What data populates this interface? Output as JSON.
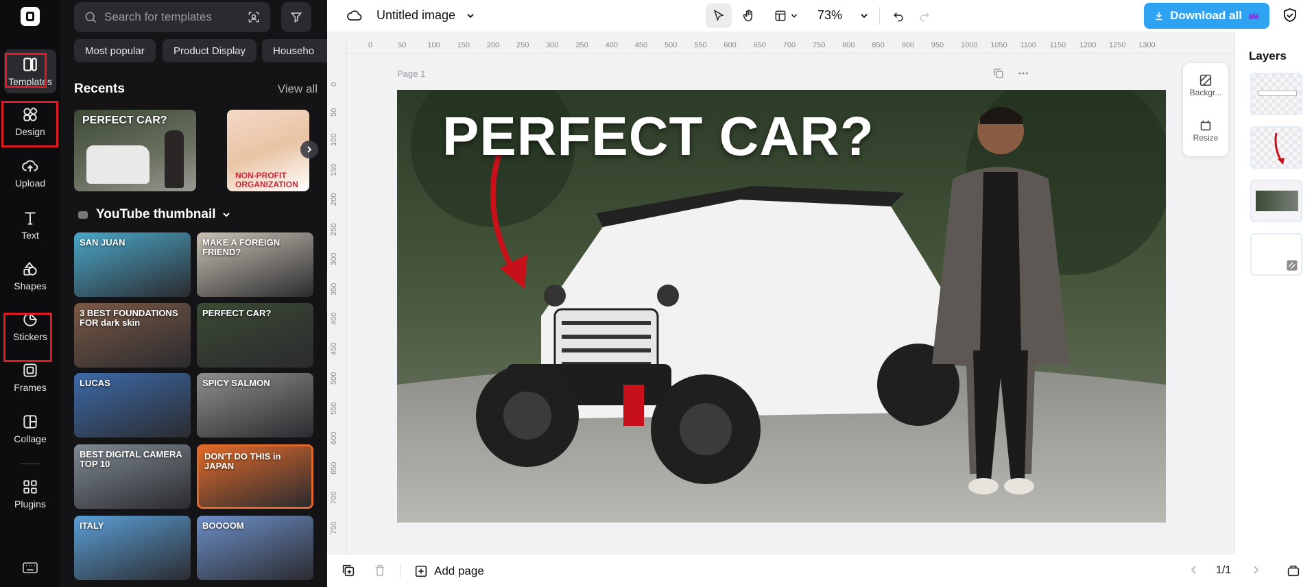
{
  "rail": {
    "items": [
      {
        "label": "Templates",
        "icon": "templates-icon"
      },
      {
        "label": "Design",
        "icon": "design-icon"
      },
      {
        "label": "Upload",
        "icon": "upload-icon"
      },
      {
        "label": "Text",
        "icon": "text-icon"
      },
      {
        "label": "Shapes",
        "icon": "shapes-icon"
      },
      {
        "label": "Stickers",
        "icon": "stickers-icon"
      },
      {
        "label": "Frames",
        "icon": "frames-icon"
      },
      {
        "label": "Collage",
        "icon": "collage-icon"
      },
      {
        "label": "Plugins",
        "icon": "plugins-icon"
      }
    ],
    "active": "Templates"
  },
  "panel": {
    "search_placeholder": "Search for templates",
    "chips": [
      "Most popular",
      "Product Display",
      "Househo"
    ],
    "recents_title": "Recents",
    "view_all": "View all",
    "recents": [
      {
        "text": "PERFECT CAR?"
      },
      {
        "text": "NON-PROFIT ORGANIZATION"
      }
    ],
    "youtube_title": "YouTube thumbnail",
    "grid": [
      {
        "text": "SAN JUAN",
        "bg": "#4aa7c9"
      },
      {
        "text": "MAKE A FOREIGN FRIEND?",
        "bg": "#c9c2b4"
      },
      {
        "text": "3 BEST FOUNDATIONS FOR dark skin",
        "bg": "#7a5844"
      },
      {
        "text": "PERFECT CAR?",
        "bg": "#3b4a33"
      },
      {
        "text": "LUCAS",
        "bg": "#3c6aa8"
      },
      {
        "text": "SPICY SALMON",
        "bg": "#8e8e8e"
      },
      {
        "text": "BEST DIGITAL CAMERA TOP 10",
        "bg": "#7f8a93"
      },
      {
        "text": "DON'T DO THIS in JAPAN",
        "bg": "#e06a2a"
      },
      {
        "text": "ITALY",
        "bg": "#5a9fd6"
      },
      {
        "text": "BOOOOM",
        "bg": "#6c8ec7"
      }
    ]
  },
  "topbar": {
    "title": "Untitled image",
    "zoom": "73%",
    "download": "Download all"
  },
  "canvas": {
    "page_label": "Page 1",
    "headline": "PERFECT CAR?",
    "ruler_h": [
      "0",
      "50",
      "100",
      "150",
      "200",
      "250",
      "300",
      "350",
      "400",
      "450",
      "500",
      "550",
      "600",
      "650",
      "700",
      "750",
      "800",
      "850",
      "900",
      "950",
      "1000",
      "1050",
      "1100",
      "1150",
      "1200",
      "1250",
      "1300"
    ],
    "ruler_v": [
      "0",
      "50",
      "100",
      "150",
      "200",
      "250",
      "300",
      "350",
      "400",
      "450",
      "500",
      "550",
      "600",
      "650",
      "700",
      "750"
    ],
    "tools": [
      {
        "label": "Backgr..."
      },
      {
        "label": "Resize"
      }
    ]
  },
  "layers": {
    "title": "Layers"
  },
  "bottombar": {
    "add_page": "Add page",
    "page_count": "1/1"
  },
  "colors": {
    "accent": "#2ea3f2",
    "highlight": "#e01b24",
    "rail_bg": "#0d0d0f",
    "panel_bg": "#141417"
  }
}
